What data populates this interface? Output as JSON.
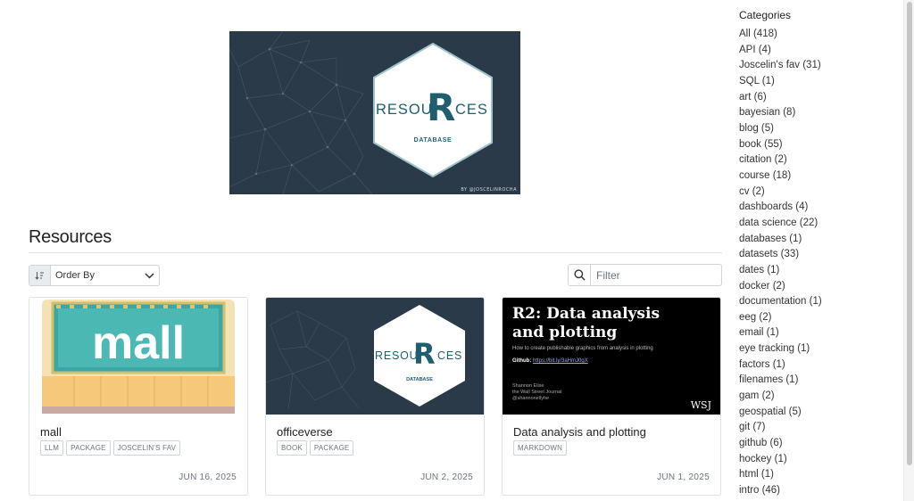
{
  "hero": {
    "logo_left": "RESOU",
    "logo_letter": "R",
    "logo_right": "CES",
    "logo_sub": "DATABASE",
    "byline": "BY @JOSCELINROCHA"
  },
  "main": {
    "title": "Resources",
    "order_by_label": "Order By",
    "filter_placeholder": "Filter"
  },
  "cards": [
    {
      "title": "mall",
      "tags": [
        "LLM",
        "PACKAGE",
        "JOSCELIN'S FAV"
      ],
      "date": "JUN 16, 2025",
      "thumb_text": "mall"
    },
    {
      "title": "officeverse",
      "tags": [
        "BOOK",
        "PACKAGE"
      ],
      "date": "JUN 2, 2025",
      "thumb_left": "RESOU",
      "thumb_letter": "R",
      "thumb_right": "CES",
      "thumb_sub": "DATABASE"
    },
    {
      "title": "Data analysis and plotting",
      "tags": [
        "MARKDOWN"
      ],
      "date": "JUN 1, 2025",
      "thumb_heading": "R2: Data analysis and plotting",
      "thumb_subtitle": "How to create publishable graphics from analysis in plotting",
      "thumb_github_label": "Github:",
      "thumb_github_link": "https://bit.ly/3aHmJ0gX",
      "thumb_footer": [
        "Shannon Elise",
        "the Wall Street Journal",
        "@shannonellyhe"
      ],
      "thumb_logo": "WSJ"
    }
  ],
  "sidebar": {
    "title": "Categories",
    "items": [
      "All (418)",
      "API (4)",
      "Joscelin's fav (31)",
      "SQL (1)",
      "art (6)",
      "bayesian (8)",
      "blog (5)",
      "book (55)",
      "citation (2)",
      "course (18)",
      "cv (2)",
      "dashboards (4)",
      "data science (22)",
      "databases (1)",
      "datasets (33)",
      "dates (1)",
      "docker (2)",
      "documentation (1)",
      "eeg (2)",
      "email (1)",
      "eye tracking (1)",
      "factors (1)",
      "filenames (1)",
      "gam (2)",
      "geospatial (5)",
      "git (7)",
      "github (6)",
      "hockey (1)",
      "html (1)",
      "intro (46)"
    ]
  },
  "colors": {
    "hero_bg": "#2b3a48",
    "logo_teal": "#1f5e6e",
    "text": "#212529",
    "muted": "#6c757d"
  }
}
